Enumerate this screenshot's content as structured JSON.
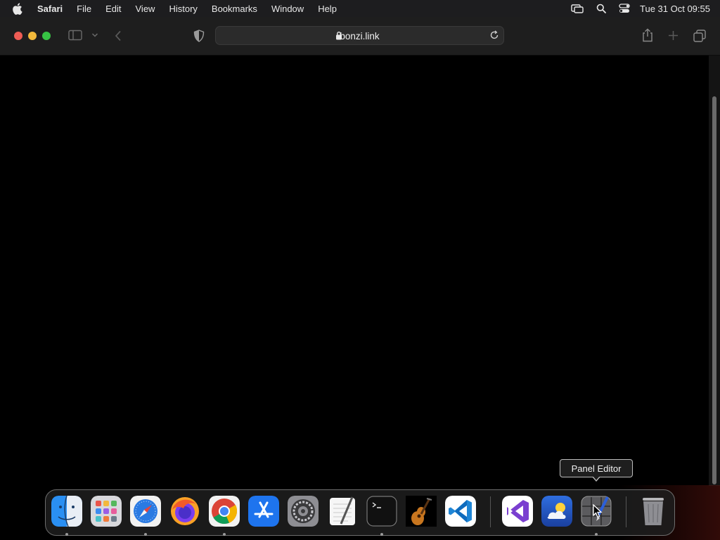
{
  "menubar": {
    "app": "Safari",
    "items": [
      "File",
      "Edit",
      "View",
      "History",
      "Bookmarks",
      "Window",
      "Help"
    ],
    "clock": "Tue 31 Oct  09:55"
  },
  "toolbar": {
    "url": "bonzi.link"
  },
  "tooltip": {
    "text": "Panel Editor"
  },
  "dock": {
    "apps": [
      "Finder",
      "Launchpad",
      "Safari",
      "Firefox",
      "Google Chrome",
      "App Store",
      "System Settings",
      "TextEdit",
      "Terminal",
      "GarageBand",
      "Visual Studio Code",
      "Visual Studio",
      "Weather",
      "Panel Editor",
      "Trash"
    ]
  },
  "colors": {
    "close": "#ee5c54",
    "minimize": "#f2b93b",
    "maximize": "#37c244"
  }
}
